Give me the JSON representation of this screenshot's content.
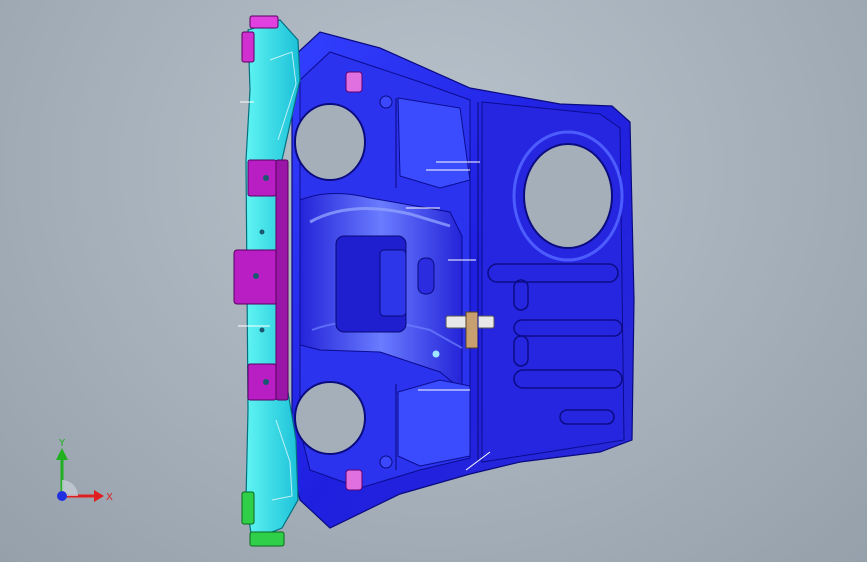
{
  "viewport": {
    "background_color": "#a6b0ba",
    "model_colors": {
      "floor_panel": "#2a25e6",
      "floor_highlight": "#4a63ff",
      "side_rail": "#2fe3e6",
      "brackets": "#c020c8",
      "end_caps": "#2fcf4a",
      "holes": "#a4afb9"
    }
  },
  "triad": {
    "x_label": "X",
    "y_label": "Y",
    "x_color": "#e02020",
    "y_color": "#20b020",
    "z_color": "#2030e0"
  }
}
